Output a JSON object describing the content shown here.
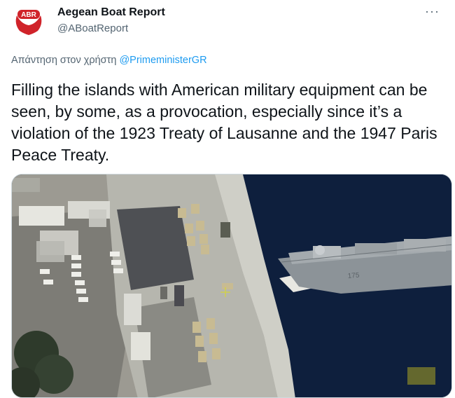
{
  "tweet": {
    "author_name": "Aegean Boat Report",
    "author_handle": "@ABoatReport",
    "avatar_text": "ABR",
    "more_label": "···",
    "reply_prefix": "Απάντηση στον χρήστη ",
    "reply_to": "@PrimeministerGR",
    "text": "Filling the islands with American military equipment can be seen, by some, as a provocation, especially since it’s a violation of the 1923 Treaty of Lausanne and the 1947 Paris Peace Treaty.",
    "ship_hull_number": "175"
  },
  "colors": {
    "brand_red": "#d0232a",
    "link_blue": "#1d9bf0",
    "secondary_text": "#536471",
    "sea": "#0c1a33",
    "pier": "#b6b6ae"
  }
}
